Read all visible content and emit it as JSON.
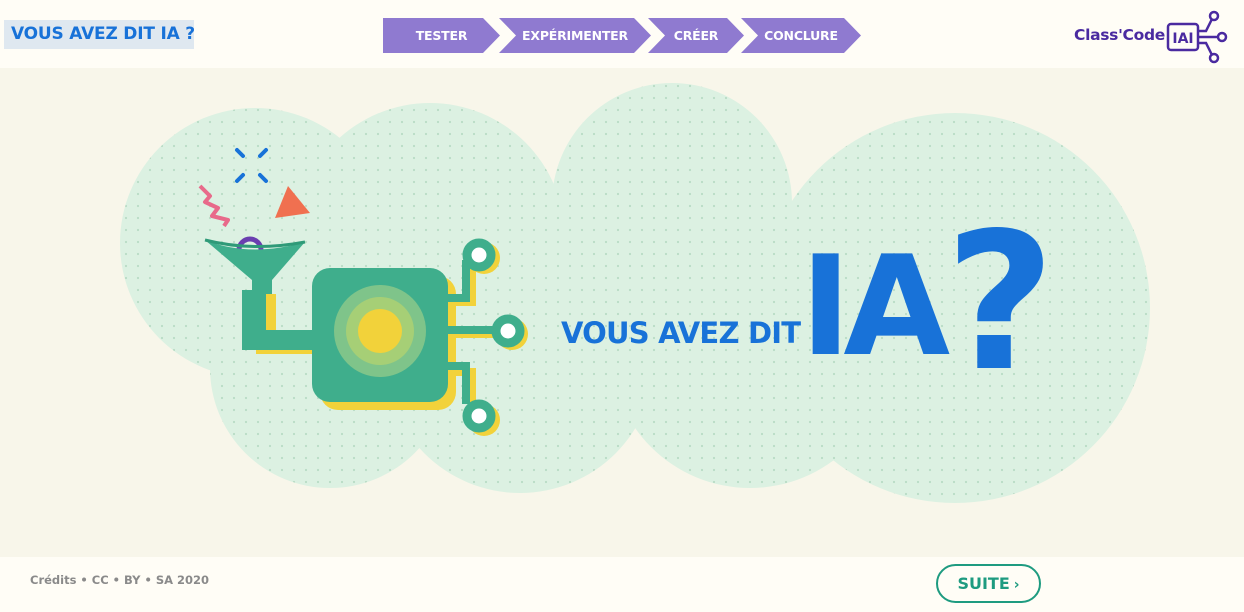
{
  "header": {
    "site_title": "VOUS AVEZ DIT IA ?",
    "steps": [
      {
        "label": "TESTER"
      },
      {
        "label": "EXPÉRIMENTER"
      },
      {
        "label": "CRÉER"
      },
      {
        "label": "CONCLURE"
      }
    ],
    "logo_text": "Class'Code",
    "logo_badge": "IAI"
  },
  "hero": {
    "label": "VOUS AVEZ DIT",
    "ia": "IA",
    "question": "?"
  },
  "footer": {
    "credits": "Crédits • CC • BY • SA 2020",
    "next_label": "SUITE",
    "next_icon": "chevron-right-icon"
  },
  "colors": {
    "accent_blue": "#1872d8",
    "step_purple": "#8f7ad0",
    "logo_purple": "#4a2aa0",
    "teal": "#1e9b80",
    "cloud": "#dcf1e2",
    "robot_green": "#3fae8c",
    "robot_yellow": "#f2d23a",
    "shape_orange": "#f07050",
    "shape_pink": "#e86a8a"
  }
}
